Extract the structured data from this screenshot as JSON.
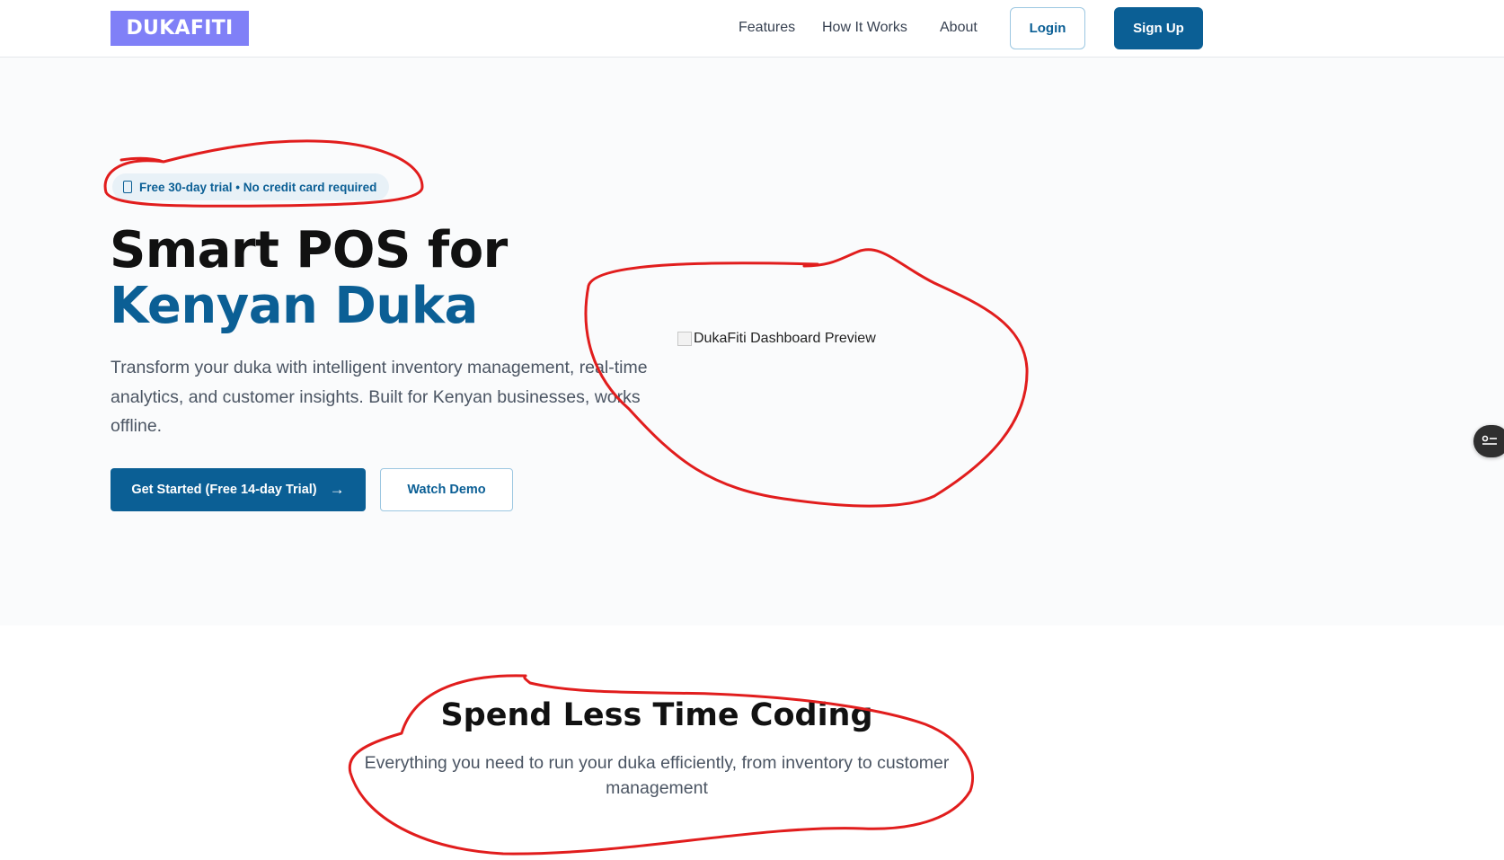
{
  "nav": {
    "logo": "DUKAFITI",
    "links": [
      "Features",
      "How It Works",
      "About"
    ],
    "login": "Login",
    "signup": "Sign Up"
  },
  "hero": {
    "badge": "Free 30-day trial • No credit card required",
    "headline_line1": "Smart POS for",
    "headline_line2": "Kenyan Duka",
    "description": "Transform your duka with intelligent inventory management, real-time analytics, and customer insights. Built for Kenyan businesses, works offline.",
    "cta_primary": "Get Started (Free 14-day Trial)",
    "cta_secondary": "Watch Demo",
    "preview_alt": "DukaFiti Dashboard Preview"
  },
  "features_section": {
    "title": "Spend Less Time Coding",
    "subtitle": "Everything you need to run your duka efficiently, from inventory to customer management"
  },
  "colors": {
    "primary": "#0b5f95",
    "logo_bg": "#8080f7",
    "annotation": "#e11d1d"
  },
  "icons": [
    "smartphone-icon",
    "arrow-right-icon",
    "broken-image-icon",
    "list-toggle-icon"
  ]
}
